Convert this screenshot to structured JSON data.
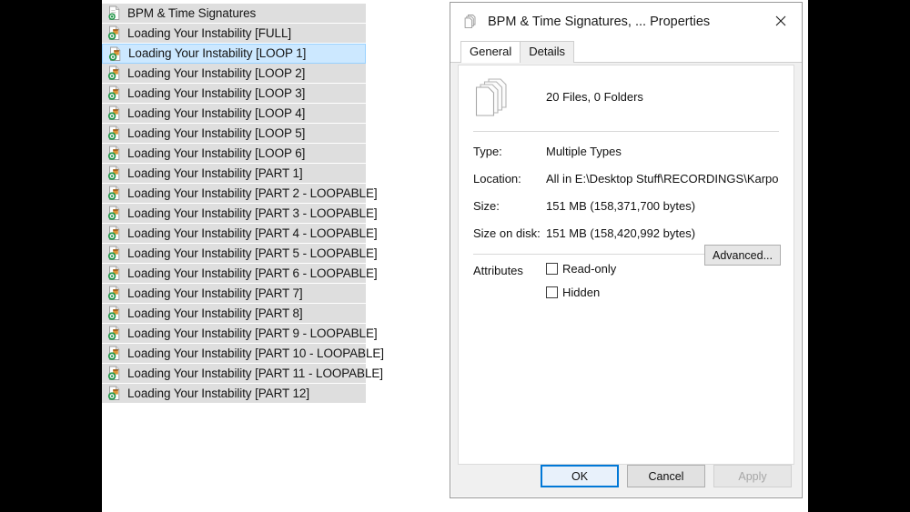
{
  "window": {
    "desktop_background": "#ffffff",
    "letterbox_color": "#000000"
  },
  "file_list": {
    "selected_index": 2,
    "items": [
      {
        "icon": "document-file-icon",
        "label": "BPM & Time Signatures"
      },
      {
        "icon": "audio-file-icon",
        "label": "Loading Your Instability [FULL]"
      },
      {
        "icon": "audio-file-icon",
        "label": "Loading Your Instability [LOOP 1]"
      },
      {
        "icon": "audio-file-icon",
        "label": "Loading Your Instability [LOOP 2]"
      },
      {
        "icon": "audio-file-icon",
        "label": "Loading Your Instability [LOOP 3]"
      },
      {
        "icon": "audio-file-icon",
        "label": "Loading Your Instability [LOOP 4]"
      },
      {
        "icon": "audio-file-icon",
        "label": "Loading Your Instability [LOOP 5]"
      },
      {
        "icon": "audio-file-icon",
        "label": "Loading Your Instability [LOOP 6]"
      },
      {
        "icon": "audio-file-icon",
        "label": "Loading Your Instability [PART 1]"
      },
      {
        "icon": "audio-file-icon",
        "label": "Loading Your Instability [PART 2 - LOOPABLE]"
      },
      {
        "icon": "audio-file-icon",
        "label": "Loading Your Instability [PART 3 - LOOPABLE]"
      },
      {
        "icon": "audio-file-icon",
        "label": "Loading Your Instability [PART 4 - LOOPABLE]"
      },
      {
        "icon": "audio-file-icon",
        "label": "Loading Your Instability [PART 5 - LOOPABLE]"
      },
      {
        "icon": "audio-file-icon",
        "label": "Loading Your Instability [PART 6 - LOOPABLE]"
      },
      {
        "icon": "audio-file-icon",
        "label": "Loading Your Instability [PART 7]"
      },
      {
        "icon": "audio-file-icon",
        "label": "Loading Your Instability [PART 8]"
      },
      {
        "icon": "audio-file-icon",
        "label": "Loading Your Instability [PART 9 - LOOPABLE]"
      },
      {
        "icon": "audio-file-icon",
        "label": "Loading Your Instability [PART 10 - LOOPABLE]"
      },
      {
        "icon": "audio-file-icon",
        "label": "Loading Your Instability [PART 11 - LOOPABLE]"
      },
      {
        "icon": "audio-file-icon",
        "label": "Loading Your Instability [PART 12]"
      }
    ],
    "selection_fill": "#cce8ff",
    "selection_border": "#99d1ff",
    "row_fill": "#dedede"
  },
  "dialog": {
    "title": "BPM & Time Signatures, ... Properties",
    "title_icon": "multi-file-stack-icon",
    "close_icon": "✕",
    "tabs": [
      {
        "label": "General",
        "active": true
      },
      {
        "label": "Details",
        "active": false
      }
    ],
    "summary": {
      "icon": "multi-file-stack-icon",
      "text": "20 Files, 0 Folders"
    },
    "info": [
      {
        "key": "Type:",
        "value": "Multiple Types"
      },
      {
        "key": "Location:",
        "value": "All in E:\\Desktop Stuff\\RECORDINGS\\KarpoSoundtr"
      },
      {
        "key": "Size:",
        "value": "151 MB (158,371,700 bytes)"
      },
      {
        "key": "Size on disk:",
        "value": "151 MB (158,420,992 bytes)"
      }
    ],
    "attributes": {
      "label": "Attributes",
      "checkboxes": [
        {
          "label": "Read-only",
          "checked": false
        },
        {
          "label": "Hidden",
          "checked": false
        }
      ],
      "advanced_button": "Advanced..."
    },
    "buttons": [
      {
        "label": "OK",
        "style": "default"
      },
      {
        "label": "Cancel",
        "style": "normal"
      },
      {
        "label": "Apply",
        "style": "disabled"
      }
    ],
    "accent_color": "#0078d7"
  }
}
